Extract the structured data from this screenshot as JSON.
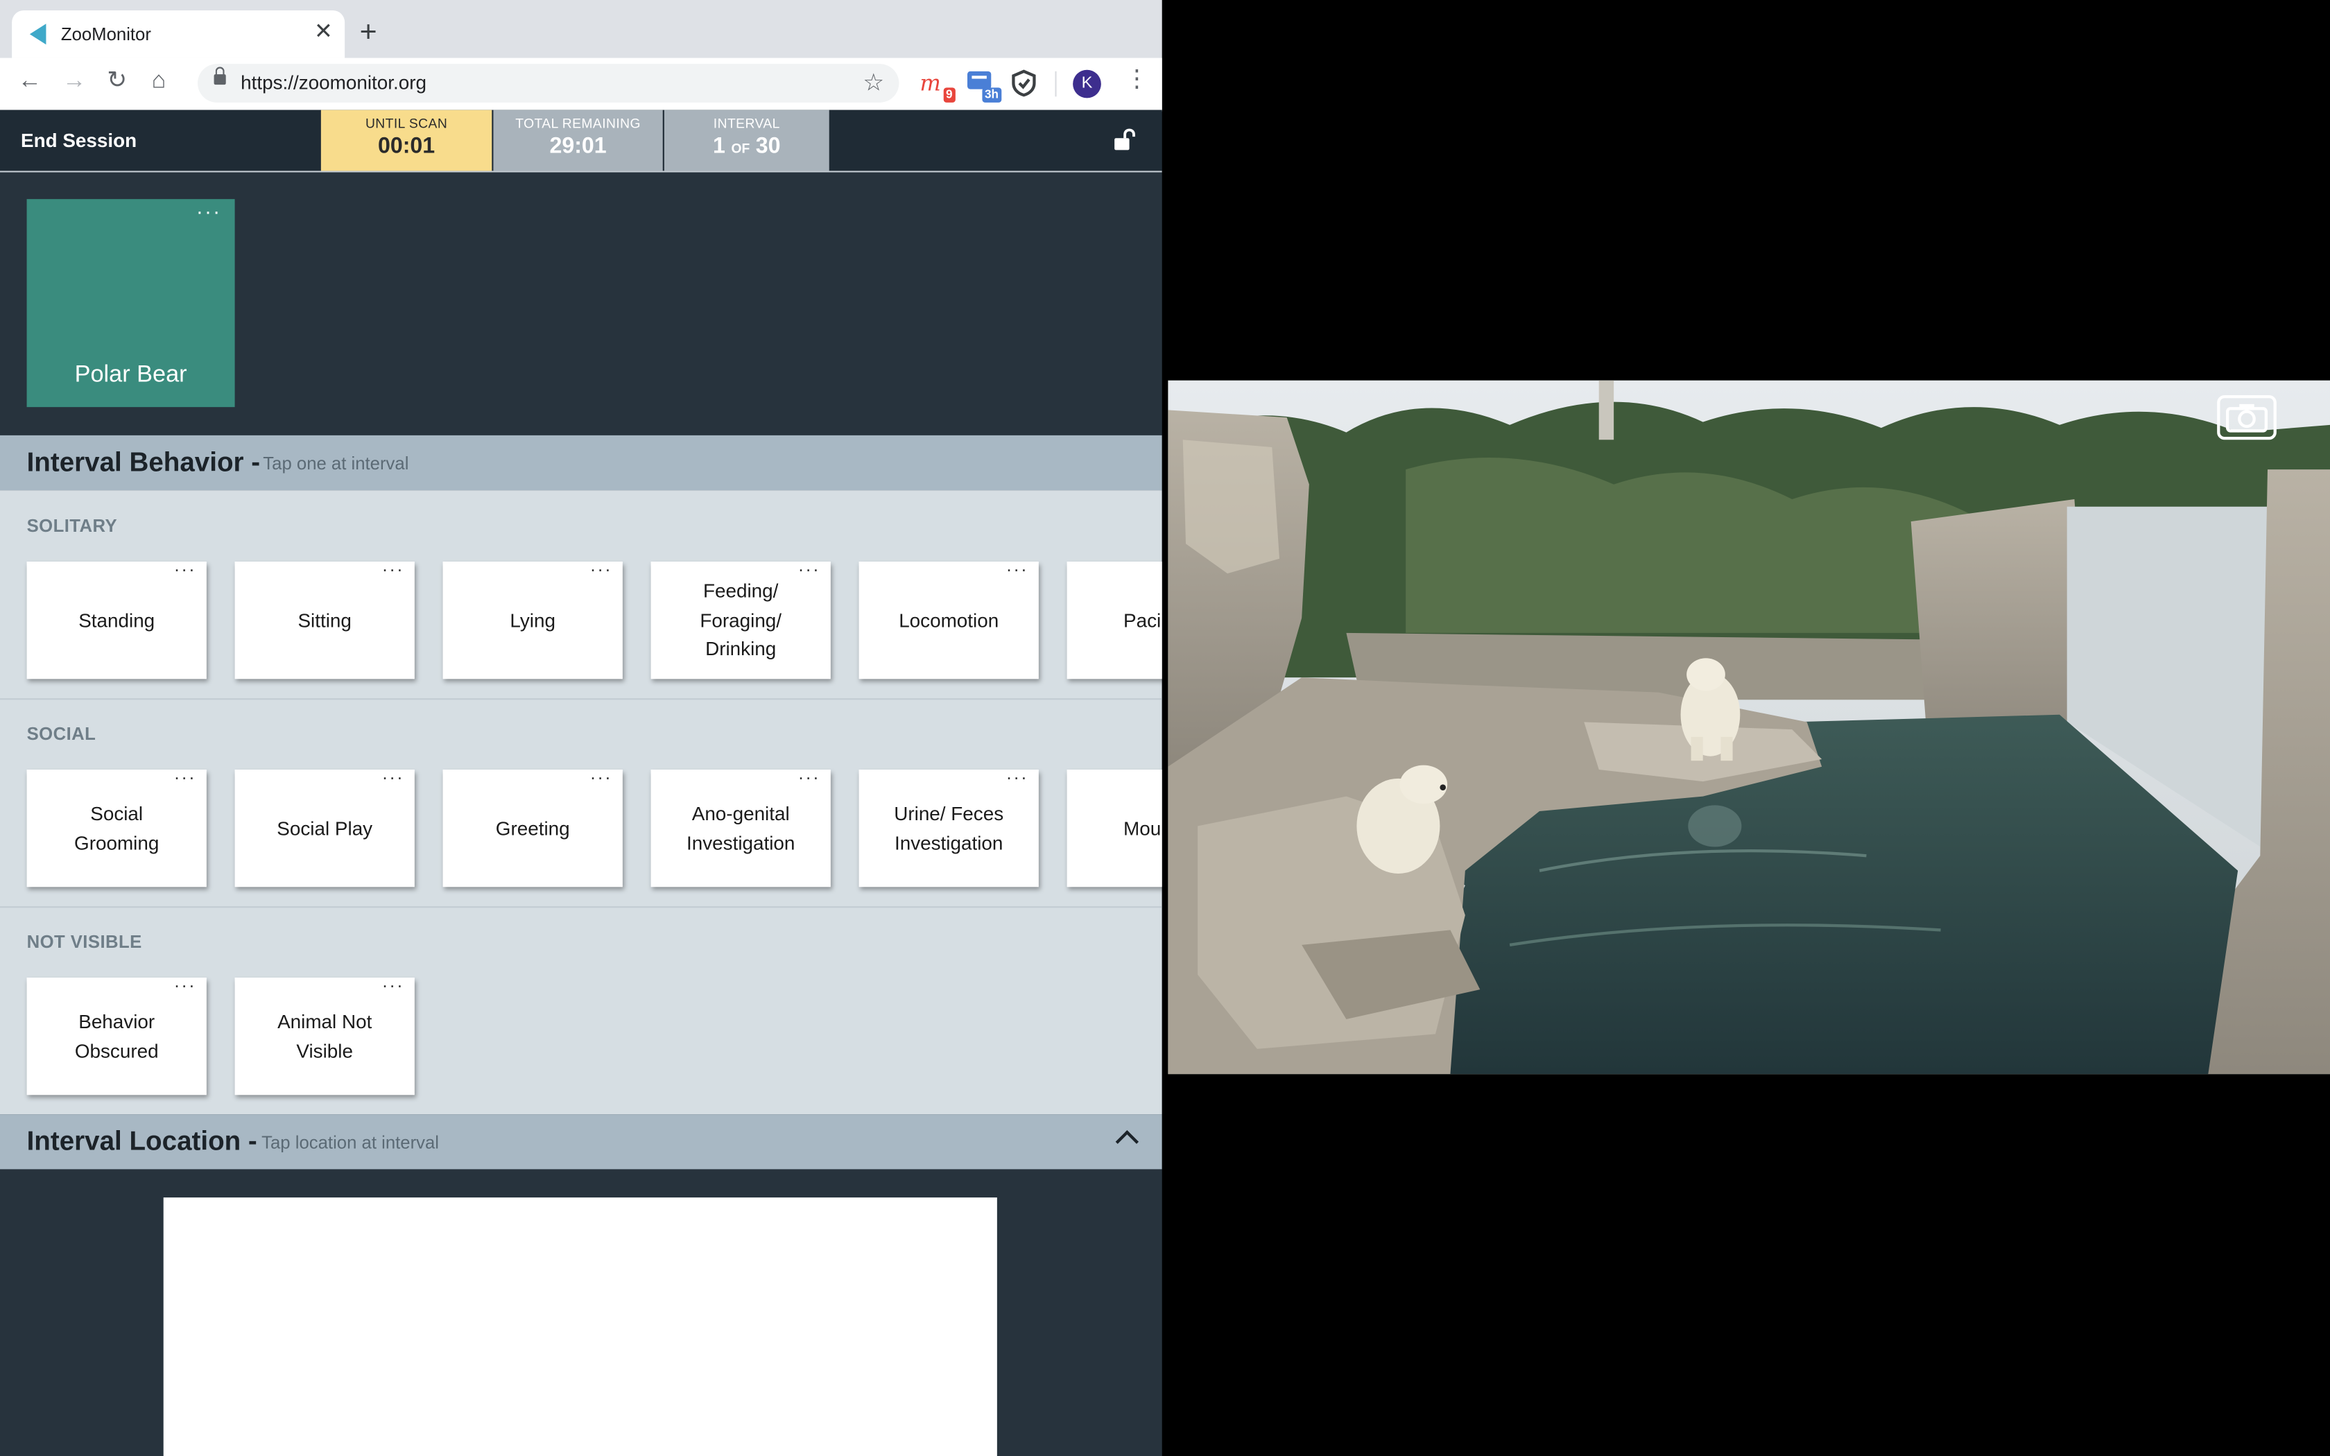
{
  "browser": {
    "tab_title": "ZooMonitor",
    "url": "https://zoomonitor.org",
    "profile_initial": "K",
    "extensions": [
      {
        "name": "m-extension-icon",
        "badge": "9",
        "color": "#e8453c"
      },
      {
        "name": "chat-extension-icon",
        "badge": "3h",
        "color": "#4a7fd6"
      },
      {
        "name": "shield-extension-icon",
        "badge": "",
        "color": "#3c4043"
      }
    ]
  },
  "session": {
    "end_label": "End Session",
    "until_scan_label": "UNTIL SCAN",
    "until_scan_value": "00:01",
    "total_remaining_label": "TOTAL REMAINING",
    "total_remaining_value": "29:01",
    "interval_label": "INTERVAL",
    "interval_current": "1",
    "interval_of": "OF",
    "interval_total": "30"
  },
  "subject": {
    "name": "Polar Bear",
    "menu": "···"
  },
  "interval_behavior": {
    "title": "Interval Behavior -",
    "hint": "Tap one at interval",
    "groups": [
      {
        "label": "SOLITARY",
        "items": [
          "Standing",
          "Sitting",
          "Lying",
          "Feeding/\nForaging/\nDrinking",
          "Locomotion",
          "Pacing"
        ]
      },
      {
        "label": "SOCIAL",
        "items": [
          "Social\nGrooming",
          "Social Play",
          "Greeting",
          "Ano-genital\nInvestigation",
          "Urine/ Feces\nInvestigation",
          "Mounting"
        ]
      },
      {
        "label": "NOT VISIBLE",
        "items": [
          "Behavior\nObscured",
          "Animal Not\nVisible"
        ]
      }
    ],
    "card_menu": "···"
  },
  "interval_location": {
    "title": "Interval Location -",
    "hint": "Tap location at interval"
  },
  "colors": {
    "accent_subject": "#3a8c7e",
    "until_scan_bg": "#f8dc8c",
    "app_dark": "#1f2b35"
  }
}
